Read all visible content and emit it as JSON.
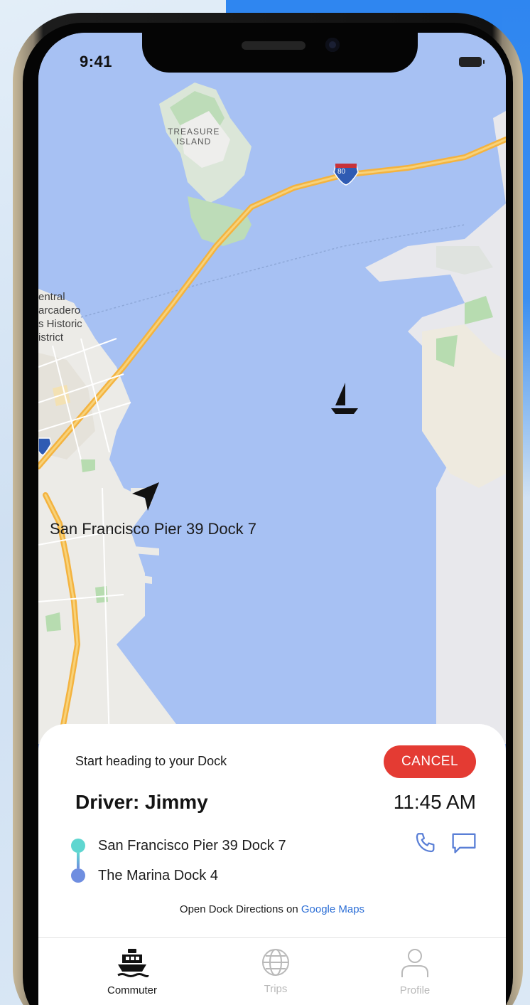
{
  "status_bar": {
    "time": "9:41"
  },
  "map": {
    "island_label": "TREASURE\nISLAND",
    "shield_80": "80",
    "district_label_lines": [
      "entral",
      "arcadero",
      "s Historic",
      "istrict"
    ],
    "dock_label": "San Francisco Pier 39 Dock 7"
  },
  "trip": {
    "status_text": "Start heading to your Dock",
    "cancel_label": "CANCEL",
    "driver": "Driver: Jimmy",
    "eta": "11:45 AM",
    "stops": [
      {
        "name": "San Francisco Pier 39 Dock 7",
        "color": "#5fd6d0"
      },
      {
        "name": "The Marina Dock 4",
        "color": "#6f8ee0"
      }
    ],
    "directions_prefix": "Open Dock Directions on",
    "directions_link": "Google Maps"
  },
  "tabs": [
    {
      "label": "Commuter",
      "icon": "ferry-icon",
      "active": true
    },
    {
      "label": "Trips",
      "icon": "globe-icon",
      "active": false
    },
    {
      "label": "Profile",
      "icon": "person-icon",
      "active": false
    }
  ],
  "colors": {
    "water": "#a7c1f3",
    "cancel": "#e43b33",
    "link": "#2d6fd6",
    "route_start": "#5fd6d0",
    "route_end": "#6f8ee0"
  }
}
